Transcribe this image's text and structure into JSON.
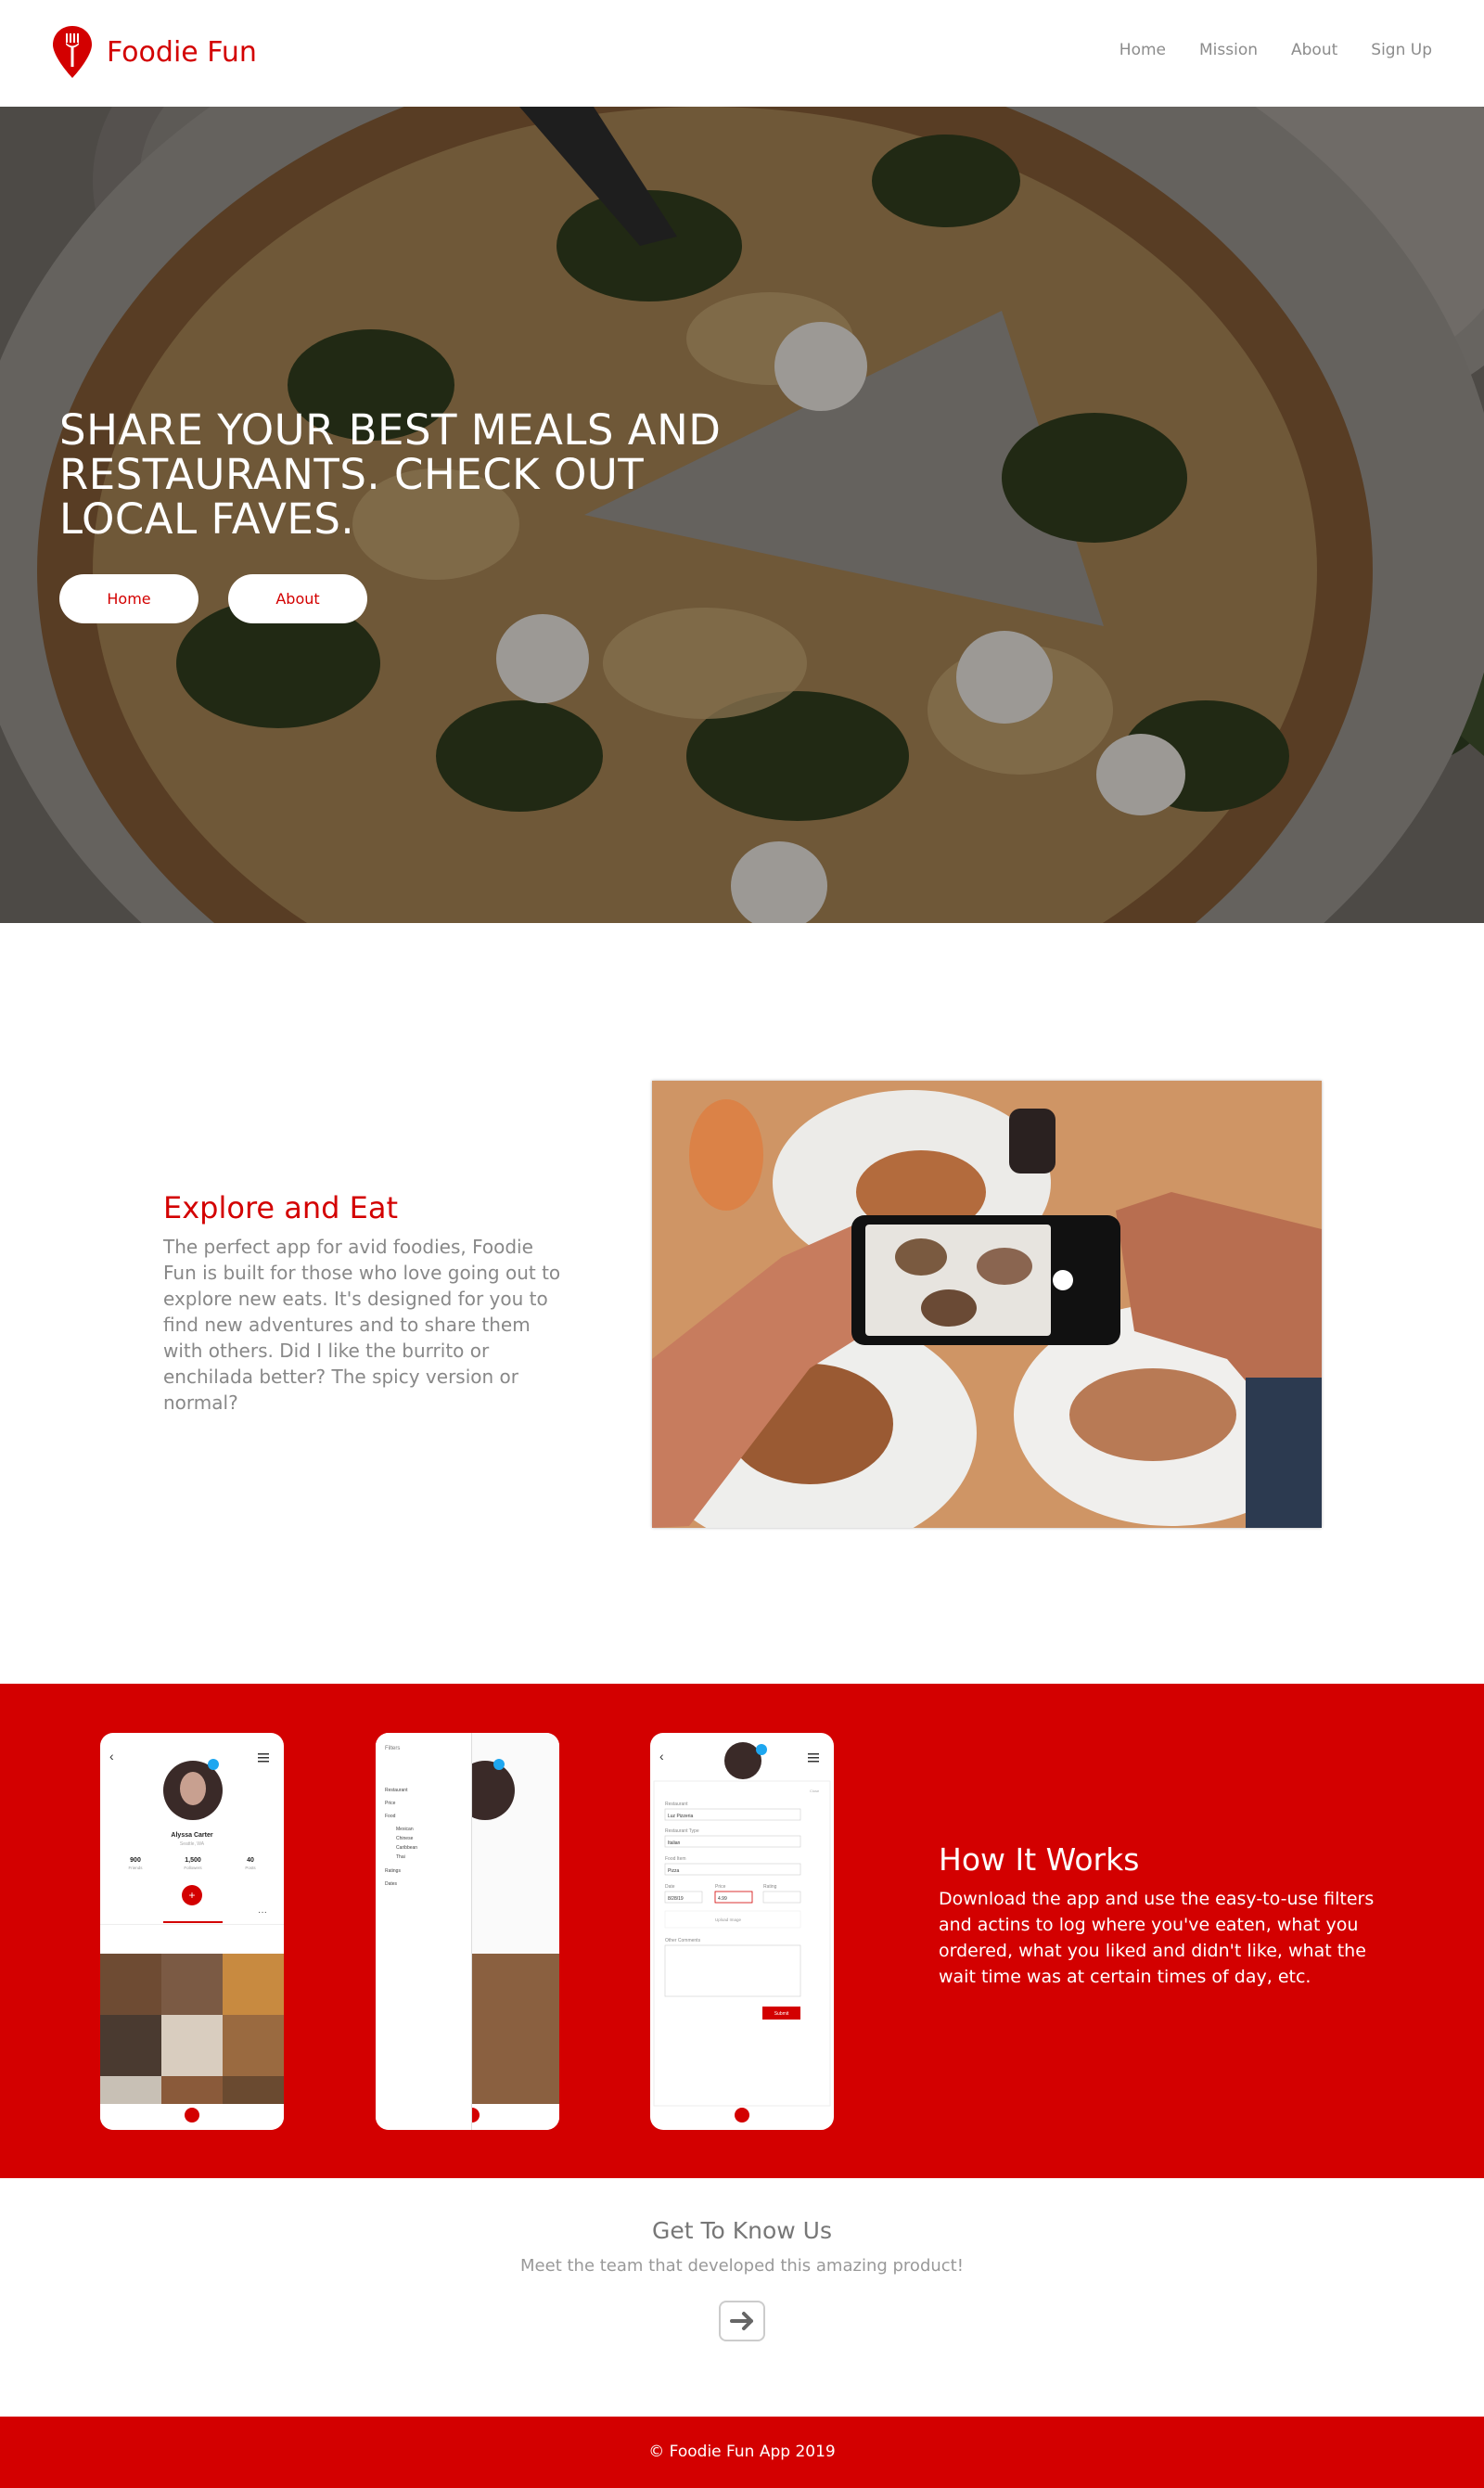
{
  "brand": {
    "name": "Foodie Fun",
    "accent": "#d30000"
  },
  "nav": {
    "links": [
      "Home",
      "Mission",
      "About",
      "Sign Up"
    ]
  },
  "hero": {
    "headline": "SHARE YOUR BEST MEALS AND RESTAURANTS. CHECK OUT LOCAL FAVES.",
    "buttons": [
      "Home",
      "About"
    ]
  },
  "explore": {
    "title": "Explore and Eat",
    "text": "The perfect app for avid foodies, Foodie Fun is built for those who love going out to explore new eats. It's designed for you to find new adventures and to share them with others. Did I like the burrito or enchilada better? The spicy version or normal?"
  },
  "how": {
    "title": "How It Works",
    "text": "Download the app and use the easy-to-use filters and actins to log where you've eaten, what you ordered, what you liked and didn't like, what the wait time was at certain times of day, etc.",
    "profile": {
      "name": "Alyssa Carter",
      "location": "Seattle, WA",
      "stats": [
        {
          "value": "900",
          "label": "Friends"
        },
        {
          "value": "1,500",
          "label": "Followers"
        },
        {
          "value": "40",
          "label": "Posts"
        }
      ]
    },
    "filters": {
      "title": "Filters",
      "items": [
        "Restaurant",
        "Price",
        "Food",
        "Mexican",
        "Chinese",
        "Caribbean",
        "Thai",
        "Ratings",
        "Dates"
      ]
    },
    "form": {
      "cancel": "Close",
      "fields": [
        {
          "label": "Restaurant",
          "value": "Luz Pizzeria"
        },
        {
          "label": "Restaurant Type",
          "value": "Italian"
        },
        {
          "label": "Food Item",
          "value": "Pizza"
        }
      ],
      "date_label": "Date",
      "date_value": "8/28/19",
      "price_label": "Price",
      "price_value": "4.99",
      "rating_label": "Rating",
      "upload": "Upload Image",
      "comments": "Other Comments",
      "submit": "Submit"
    }
  },
  "team": {
    "title": "Get To Know Us",
    "subtitle": "Meet the team that developed this amazing product!"
  },
  "footer": {
    "text": "© Foodie Fun App 2019"
  }
}
